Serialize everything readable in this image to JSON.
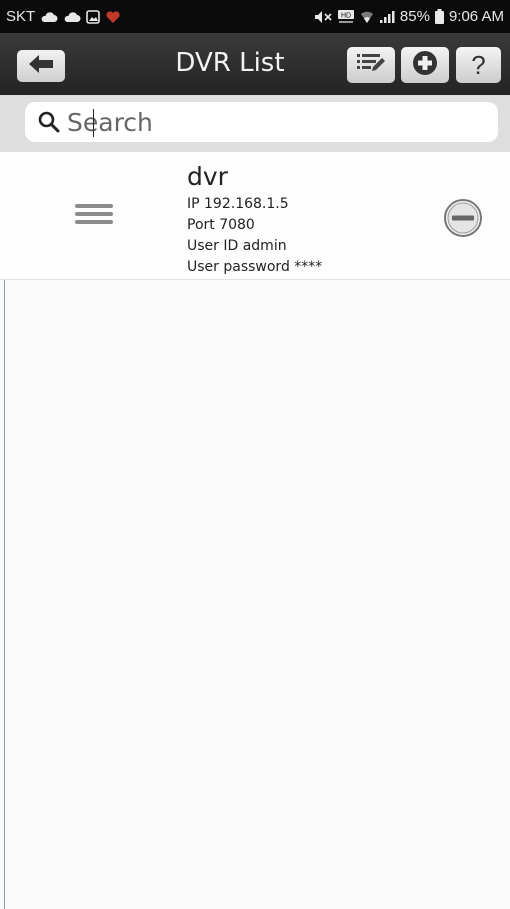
{
  "statusbar": {
    "carrier": "SKT",
    "battery": "85%",
    "time": "9:06 AM"
  },
  "toolbar": {
    "title": "DVR List",
    "help_label": "?"
  },
  "search": {
    "placeholder": "Search",
    "value": ""
  },
  "dvr_list": [
    {
      "name": "dvr",
      "ip": "IP 192.168.1.5",
      "port": "Port 7080",
      "user_id": "User ID admin",
      "password": "User password ****"
    }
  ]
}
